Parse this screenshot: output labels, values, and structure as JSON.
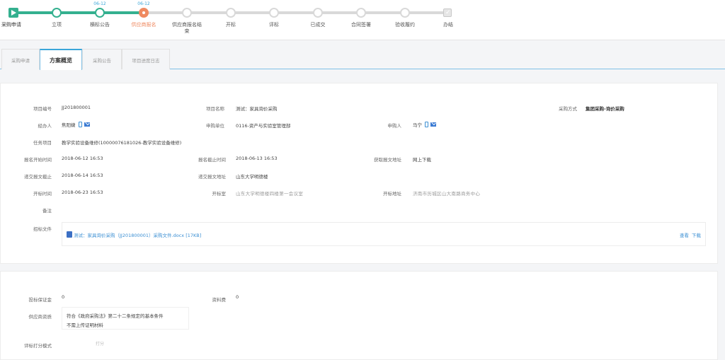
{
  "progress": {
    "steps": [
      {
        "label": "采购申请",
        "state": "done",
        "date": ""
      },
      {
        "label": "立项",
        "state": "done",
        "date": ""
      },
      {
        "label": "横标公告",
        "state": "done",
        "date": "06-12"
      },
      {
        "label": "供应商报名",
        "state": "current",
        "date": "06-12"
      },
      {
        "label": "供应商报名结束",
        "state": "todo",
        "date": ""
      },
      {
        "label": "开标",
        "state": "todo",
        "date": ""
      },
      {
        "label": "评标",
        "state": "todo",
        "date": ""
      },
      {
        "label": "已成交",
        "state": "todo",
        "date": ""
      },
      {
        "label": "合同签署",
        "state": "todo",
        "date": ""
      },
      {
        "label": "验收履约",
        "state": "todo",
        "date": ""
      },
      {
        "label": "办结",
        "state": "todo",
        "date": ""
      }
    ],
    "end_check": "✓"
  },
  "tabs": [
    {
      "label": "采购申请",
      "active": false
    },
    {
      "label": "方案概览",
      "active": true
    },
    {
      "label": "采购公告",
      "active": false
    },
    {
      "label": "项目进度日志",
      "active": false
    }
  ],
  "details": {
    "project_no_label": "项目编号",
    "project_no": "JJ201800001",
    "project_name_label": "项目名称",
    "project_name": "测试：家具询价采购",
    "purchase_method_label": "采购方式",
    "purchase_method": "集团采购-询价采购",
    "handler_label": "经办人",
    "handler": "焦阳婕",
    "apply_unit_label": "申购单位",
    "apply_unit": "0116-资产与实验室管理部",
    "applicant_label": "申购人",
    "applicant": "马宁",
    "task_label": "任务项目",
    "task": "教学实验设备维修(10000076181026-教学实验设备维修)",
    "signup_start_label": "报名开始时间",
    "signup_start": "2018-06-12 16:53",
    "signup_end_label": "报名截止时间",
    "signup_end": "2018-06-13 16:53",
    "bid_address_label": "获取报文地址",
    "bid_address": "网上下载",
    "submit_deadline_label": "递交报文截止",
    "submit_deadline": "2018-06-14 16:53",
    "submit_address_label": "递交报文地址",
    "submit_address": "山东大学明德楼",
    "open_time_label": "开标时间",
    "open_time": "2018-06-23 16:53",
    "open_place_label": "开标室",
    "open_place": "山东大学明德楼四楼第一会议室",
    "open_address_label": "开标地址",
    "open_address": "济南市历城区山大南路商务中心",
    "remark_label": "备注",
    "remark": "",
    "file_label": "招标文件",
    "file_name": "测试：家具询价采购（JJ201800001）采购文件.docx [17KB]",
    "file_view": "查看",
    "file_download": "下载"
  },
  "extra": {
    "deposit_label": "投标保证金",
    "deposit": "0",
    "doc_fee_label": "资料费",
    "doc_fee": "0",
    "supplier_label": "供应商资质",
    "supplier_req_1": "符合《政府采购法》第二十二条规定的基本条件",
    "supplier_req_2": "不需上传证明材料",
    "score_label": "评标打分模式",
    "score_value": "打分"
  }
}
